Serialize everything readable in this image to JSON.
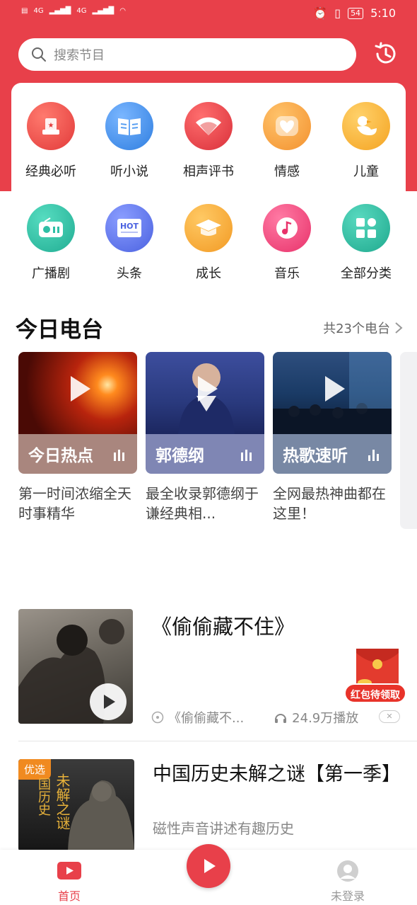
{
  "status_bar": {
    "network_left": "4G",
    "network_right": "4G",
    "battery": "54",
    "time": "5:10"
  },
  "search": {
    "placeholder": "搜索节目"
  },
  "categories": [
    {
      "label": "经典必听",
      "icon": "trophy-icon",
      "color": "#f04a4a"
    },
    {
      "label": "听小说",
      "icon": "book-icon",
      "color": "#3d8de8"
    },
    {
      "label": "相声评书",
      "icon": "fan-icon",
      "color": "#e83c46"
    },
    {
      "label": "情感",
      "icon": "heart-icon",
      "color": "#f7a03a"
    },
    {
      "label": "儿童",
      "icon": "duck-icon",
      "color": "#f7ad2c"
    },
    {
      "label": "广播剧",
      "icon": "radio-icon",
      "color": "#2ebfa5"
    },
    {
      "label": "头条",
      "icon": "hot-news-icon",
      "color": "#5a73e8"
    },
    {
      "label": "成长",
      "icon": "graduation-cap-icon",
      "color": "#f6a531"
    },
    {
      "label": "音乐",
      "icon": "music-note-icon",
      "color": "#f0457a"
    },
    {
      "label": "全部分类",
      "icon": "grid-icon",
      "color": "#2ebda1"
    }
  ],
  "today_radio": {
    "title": "今日电台",
    "more": "共23个电台",
    "items": [
      {
        "name": "今日热点",
        "desc": "第一时间浓缩全天时事精华"
      },
      {
        "name": "郭德纲",
        "desc": "最全收录郭德纲于谦经典相..."
      },
      {
        "name": "热歌速听",
        "desc": "全网最热神曲都在这里！"
      }
    ]
  },
  "recommend_1": {
    "title": "《偷偷藏不住》",
    "meta_title": "《偷偷藏不...",
    "plays": "24.9万播放"
  },
  "red_packet": {
    "label": "红包待领取"
  },
  "recommend_2": {
    "tag": "优选",
    "cover_text_1": "国历史",
    "cover_text_2": "未解之谜",
    "title": "中国历史未解之谜【第一季】",
    "subtitle": "磁性声音讲述有趣历史"
  },
  "tabbar": {
    "home": "首页",
    "login": "未登录"
  },
  "colors": {
    "brand_red": "#e8404a"
  }
}
